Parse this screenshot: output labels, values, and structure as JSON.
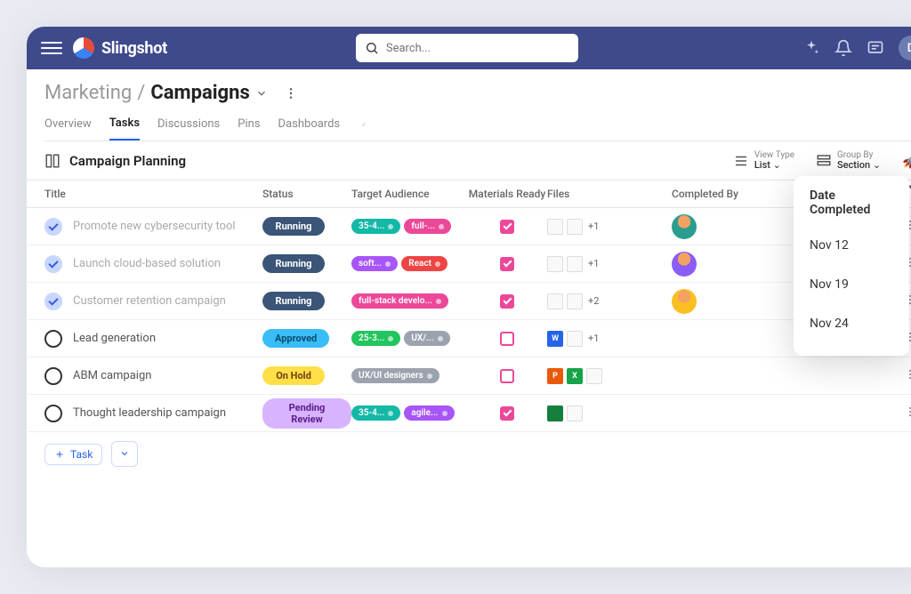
{
  "brand": "Slingshot",
  "search_placeholder": "Search...",
  "user_initial": "D",
  "breadcrumb": {
    "parent": "Marketing",
    "current": "Campaigns"
  },
  "tabs": [
    "Overview",
    "Tasks",
    "Discussions",
    "Pins",
    "Dashboards"
  ],
  "active_tab": "Tasks",
  "section_title": "Campaign Planning",
  "view_type": {
    "label": "View Type",
    "value": "List"
  },
  "group_by": {
    "label": "Group By",
    "value": "Section"
  },
  "columns": {
    "title": "Title",
    "status": "Status",
    "target": "Target Audience",
    "materials": "Materials Ready",
    "files": "Files",
    "completed_by": "Completed By"
  },
  "rows": [
    {
      "done": true,
      "title": "Promote new cybersecurity tool",
      "status": "Running",
      "status_class": "pill-running",
      "tags": [
        {
          "text": "35-4...",
          "class": "tag-teal"
        },
        {
          "text": "full-...",
          "class": "tag-pink"
        }
      ],
      "materials": true,
      "files_extra": "+1",
      "avatar_class": "av-1"
    },
    {
      "done": true,
      "title": "Launch cloud-based solution",
      "status": "Running",
      "status_class": "pill-running",
      "tags": [
        {
          "text": "soft...",
          "class": "tag-purple"
        },
        {
          "text": "React",
          "class": "tag-red"
        }
      ],
      "materials": true,
      "files_extra": "+1",
      "avatar_class": "av-2"
    },
    {
      "done": true,
      "title": "Customer retention campaign",
      "status": "Running",
      "status_class": "pill-running",
      "tags": [
        {
          "text": "full-stack develo...",
          "class": "tag-pink"
        }
      ],
      "materials": true,
      "files_extra": "+2",
      "avatar_class": "av-3"
    },
    {
      "done": false,
      "title": "Lead generation",
      "status": "Approved",
      "status_class": "pill-approved",
      "tags": [
        {
          "text": "25-3...",
          "class": "tag-green"
        },
        {
          "text": "UX/...",
          "class": "tag-gray"
        }
      ],
      "materials": false,
      "files_ms": [
        {
          "t": "W",
          "c": "file-w"
        }
      ],
      "files_extra": "+1",
      "avatar_class": ""
    },
    {
      "done": false,
      "title": "ABM campaign",
      "status": "On Hold",
      "status_class": "pill-onhold",
      "tags": [
        {
          "text": "UX/UI designers",
          "class": "tag-gray"
        }
      ],
      "materials": false,
      "files_ms": [
        {
          "t": "P",
          "c": "file-p"
        },
        {
          "t": "X",
          "c": "file-x"
        }
      ],
      "files_extra": "",
      "avatar_class": ""
    },
    {
      "done": false,
      "title": "Thought leadership campaign",
      "status": "Pending Review",
      "status_class": "pill-pending",
      "tags": [
        {
          "text": "35-4...",
          "class": "tag-teal"
        },
        {
          "text": "agile...",
          "class": "tag-purple"
        }
      ],
      "materials": true,
      "files_ms": [
        {
          "t": "",
          "c": "file-g"
        }
      ],
      "files_extra": "",
      "avatar_class": ""
    }
  ],
  "add_task_label": "Task",
  "popover": {
    "title": "Date Completed",
    "items": [
      "Nov 12",
      "Nov 19",
      "Nov 24"
    ]
  }
}
